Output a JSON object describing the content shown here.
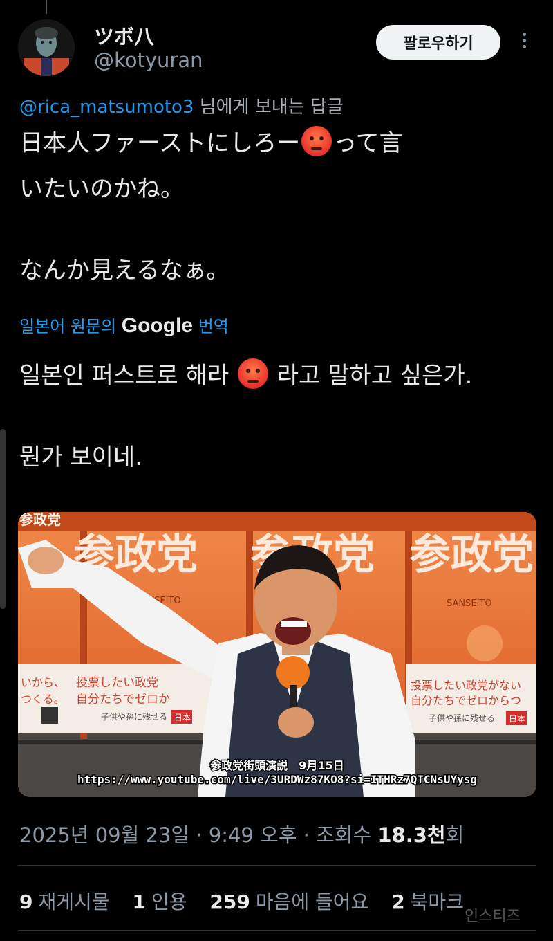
{
  "user": {
    "display_name": "ツボ八",
    "handle": "@kotyuran",
    "follow_label": "팔로우하기"
  },
  "reply": {
    "mention": "@rica_matsumoto3",
    "suffix": " 님에게 보내는 답글"
  },
  "post": {
    "line1a": "日本人ファーストにしろー",
    "line1b": "って言",
    "line2": "いたいのかね。",
    "line3": "なんか見えるなぁ。"
  },
  "translation": {
    "prefix": "일본어 원문의 ",
    "brand": "Google",
    "suffix": " 번역",
    "line1a": "일본인 퍼스트로 해라 ",
    "line1b": " 라고 말하고 싶은가.",
    "line2": "뭔가 보이네."
  },
  "media": {
    "banner_texts": [
      "参政党",
      "参政党",
      "参政党"
    ],
    "corner_text": "参政党",
    "sanseito": "SANSEITO",
    "poster_left_1": "いから、",
    "poster_left_2": "つくる。",
    "poster_mid_1": "投票したい政党",
    "poster_mid_2": "自分たちでゼロか",
    "poster_mid_3": "子供や孫に残せる",
    "poster_mid_badge": "日本",
    "poster_right_1": "投票したい政党がない",
    "poster_right_2": "自分たちでゼロからつ",
    "poster_right_3": "子供や孫に残せる",
    "poster_right_badge": "日本",
    "caption_1": "参政党街頭演説　9月15日",
    "caption_2": "https://www.youtube.com/live/3URDWz87KO8?si=ITHRz7QTCNsUYysg"
  },
  "meta": {
    "timestamp": "2025년 09월 23일 · 9:49 오후 · 조회수 ",
    "views": "18.3천",
    "views_suffix": "회"
  },
  "stats": {
    "reposts_count": "9",
    "reposts_label": "재게시물",
    "quotes_count": "1",
    "quotes_label": "인용",
    "likes_count": "259",
    "likes_label": "마음에 들어요",
    "bookmarks_count": "2",
    "bookmarks_label": "북마크"
  },
  "watermark": "인스티즈",
  "colors": {
    "accent": "#1d9bf0",
    "background": "#000000",
    "secondary_text": "#8b98a5"
  }
}
